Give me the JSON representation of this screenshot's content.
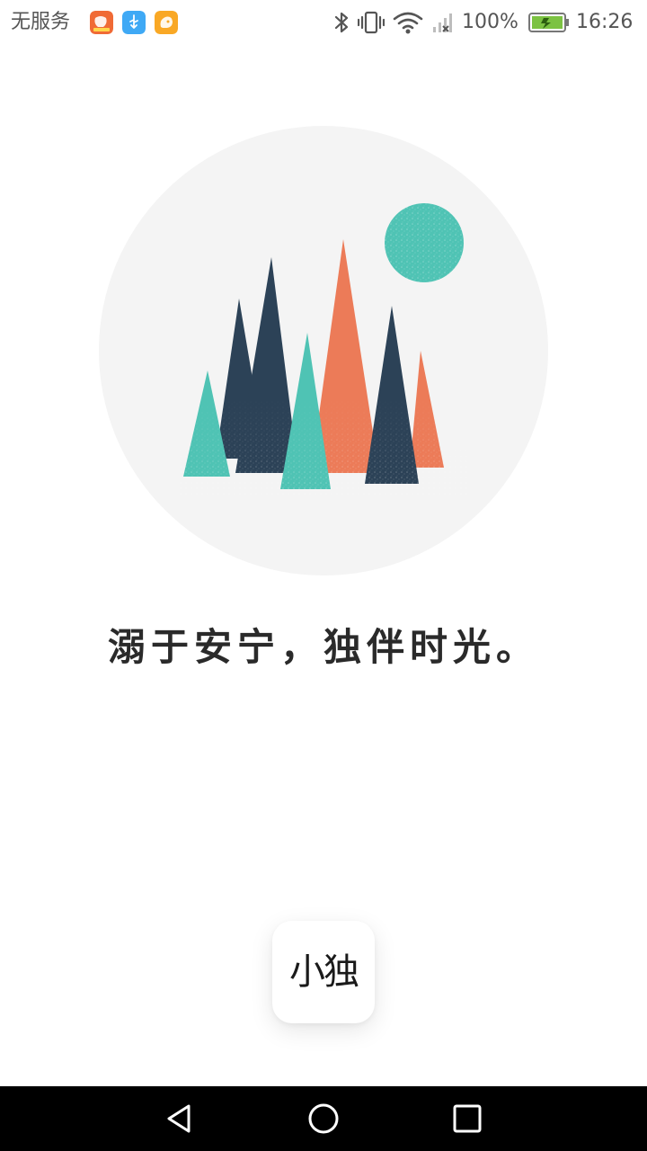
{
  "status_bar": {
    "carrier": "无服务",
    "app_icons": [
      "uc-browser-icon",
      "usb-icon",
      "uc-squirrel-icon"
    ],
    "right_icons": [
      "bluetooth-icon",
      "vibrate-icon",
      "wifi-icon",
      "signal-no-service-icon"
    ],
    "battery_percent": "100%",
    "battery_level": 1.0,
    "time": "16:26"
  },
  "hero": {
    "illustration": "mountains-and-moon",
    "colors": {
      "circle": "#f4f4f4",
      "teal": "#4fc3b4",
      "navy": "#2c4257",
      "orange": "#ec7b58"
    }
  },
  "slogan": "溺于安宁，独伴时光。",
  "logo": {
    "text": "小独"
  },
  "nav_bar": {
    "buttons": [
      "back-icon",
      "home-icon",
      "recents-icon"
    ]
  }
}
